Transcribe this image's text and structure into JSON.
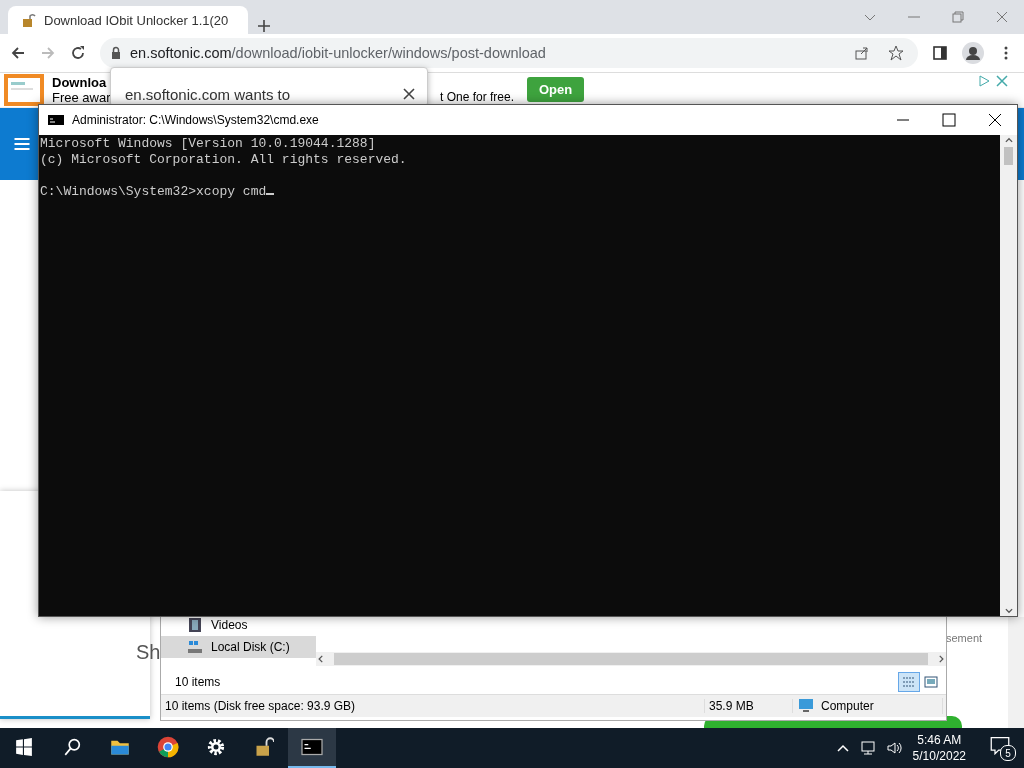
{
  "browser": {
    "tab_title": "Download IObit Unlocker 1.1(20",
    "url_host": "en.softonic.com",
    "url_path": "/download/iobit-unlocker/windows/post-download"
  },
  "page": {
    "ad_title": "Downloa",
    "ad_subtitle": "Free awar",
    "ad_tail": "t One for free.",
    "ad_button": "Open",
    "side_heading": "Sh",
    "side_text": "sement"
  },
  "popup": {
    "text": "en.softonic.com wants to"
  },
  "cmd": {
    "title": "Administrator: C:\\Windows\\System32\\cmd.exe",
    "output": [
      "Microsoft Windows [Version 10.0.19044.1288]",
      "(c) Microsoft Corporation. All rights reserved."
    ],
    "prompt": "C:\\Windows\\System32>xcopy cmd",
    "cursor": true
  },
  "explorer": {
    "nav_items": [
      {
        "kind": "video",
        "label": "Videos",
        "selected": false
      },
      {
        "kind": "disk",
        "label": "Local Disk (C:)",
        "selected": true
      }
    ],
    "item_count": "10 items",
    "views": [
      {
        "kind": "details",
        "selected": true
      },
      {
        "kind": "tiles",
        "selected": false
      }
    ],
    "status": [
      "10 items (Disk free space: 93.9 GB)",
      "35.9 MB",
      "Computer"
    ]
  },
  "taskbar": {
    "apps": [
      {
        "kind": "folder",
        "active": false
      },
      {
        "kind": "chrome",
        "active": false
      },
      {
        "kind": "gear",
        "active": false
      },
      {
        "kind": "lock",
        "active": false
      },
      {
        "kind": "console",
        "active": true
      }
    ],
    "time": "5:46 AM",
    "date": "5/10/2022",
    "notifications": "5"
  }
}
